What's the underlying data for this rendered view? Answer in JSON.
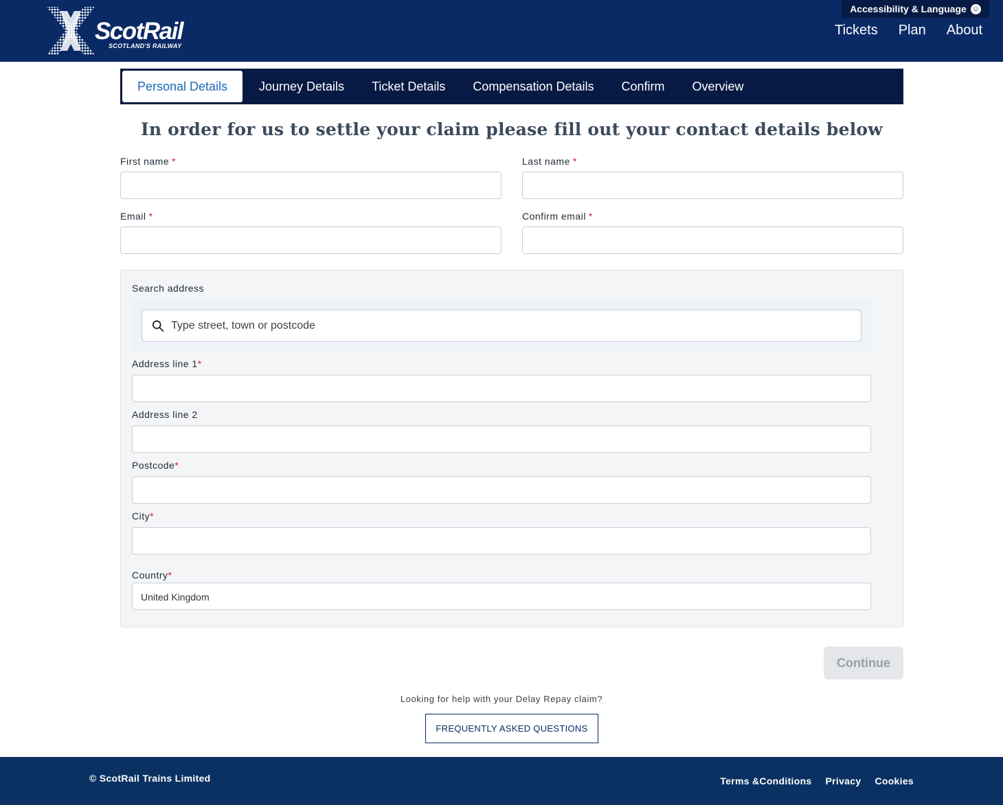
{
  "header": {
    "logo_text": "ScotRail",
    "logo_tagline": "SCOTLAND'S RAILWAY",
    "accessibility_label": "Accessibility & Language",
    "nav": [
      "Tickets",
      "Plan",
      "About"
    ]
  },
  "tabs": [
    {
      "label": "Personal Details",
      "active": true
    },
    {
      "label": "Journey Details",
      "active": false
    },
    {
      "label": "Ticket Details",
      "active": false
    },
    {
      "label": "Compensation Details",
      "active": false
    },
    {
      "label": "Confirm",
      "active": false
    },
    {
      "label": "Overview",
      "active": false
    }
  ],
  "page_title": "In order for us to settle your claim please fill out your contact details below",
  "form": {
    "first_name_label": "First name",
    "last_name_label": "Last name",
    "email_label": "Email",
    "confirm_email_label": "Confirm email",
    "required_marker": "*",
    "values": {
      "first_name": "",
      "last_name": "",
      "email": "",
      "confirm_email": ""
    }
  },
  "address": {
    "search_label": "Search address",
    "search_placeholder": "Type street, town or postcode",
    "line1_label": "Address line 1",
    "line2_label": "Address line 2",
    "postcode_label": "Postcode",
    "city_label": "City",
    "country_label": "Country",
    "country_value": "United Kingdom"
  },
  "actions": {
    "continue_label": "Continue",
    "continue_enabled": false
  },
  "help": {
    "text": "Looking for help with your Delay Repay claim?",
    "faq_label": "FREQUENTLY ASKED QUESTIONS"
  },
  "footer": {
    "copyright": "© ScotRail Trains Limited",
    "links": [
      "Terms &Conditions",
      "Privacy",
      "Cookies"
    ]
  },
  "colors": {
    "header_bg": "#0a2a66",
    "tab_bar_bg": "#061a44",
    "active_tab_text": "#1b6ab7",
    "required": "#d11a2a",
    "footer_bg": "#0a3161"
  }
}
